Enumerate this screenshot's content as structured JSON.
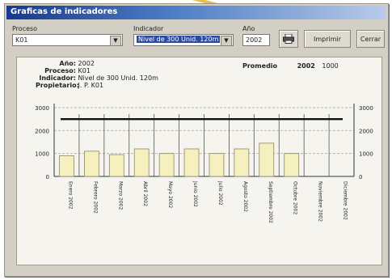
{
  "window": {
    "title": "Graficas de indicadores"
  },
  "controls": {
    "proceso_label": "Proceso",
    "proceso_value": "K01",
    "indicador_label": "Indicador",
    "indicador_value": "Nivel de 300 Unid. 120m",
    "anio_label": "Año",
    "anio_value": "2002",
    "print_icon": "printer-icon",
    "imprimir_label": "Imprimir",
    "cerrar_label": "Cerrar"
  },
  "info": {
    "anio_key": "Año:",
    "anio_val": "2002",
    "proceso_key": "Proceso:",
    "proceso_val": "K01",
    "indicador_key": "Indicador:",
    "indicador_val": "Nivel de 300 Unid. 120m",
    "propietario_key": "Propietario:",
    "propietario_val": "J. P. K01",
    "promedio_key": "Promedio",
    "promedio_year": "2002",
    "promedio_val": "1000"
  },
  "chart_data": {
    "type": "bar",
    "categories": [
      "Enero 2002",
      "Febrero 2002",
      "Marzo 2002",
      "Abril 2002",
      "Mayo 2002",
      "Junio 2002",
      "Julio 2002",
      "Agosto 2002",
      "Septiembre 2002",
      "Octubre 2002",
      "Noviembre 2002",
      "Diciembre 2002"
    ],
    "values": [
      900,
      1100,
      950,
      1200,
      1000,
      1200,
      1000,
      1200,
      1450,
      1000,
      null,
      null
    ],
    "target": 2500,
    "ylim": [
      0,
      3000
    ],
    "yticks": [
      "3000",
      "2000",
      "1000",
      "0"
    ],
    "colors": {
      "bar": "#f6f0bf",
      "bar_stroke": "#8c876a",
      "target": "#111111",
      "grid": "#b8b6ae"
    }
  }
}
